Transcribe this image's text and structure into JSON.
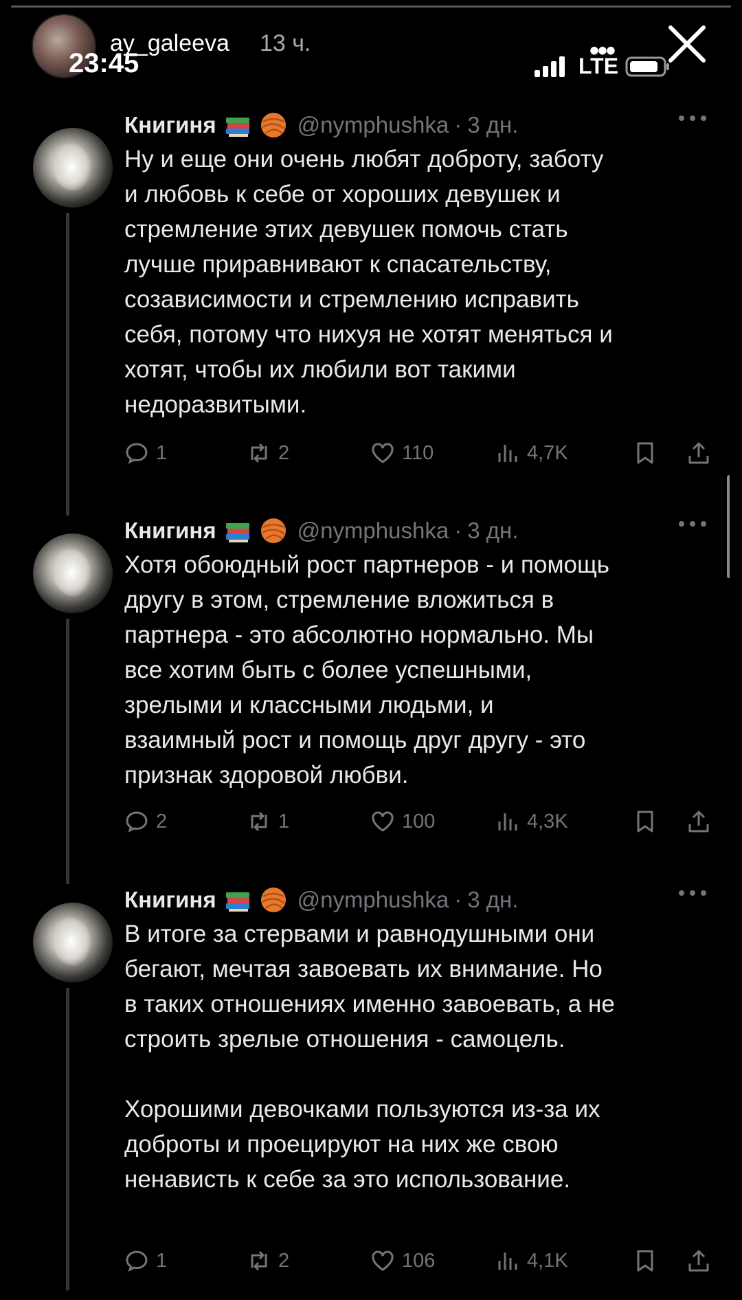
{
  "story": {
    "username": "ay_galeeva",
    "posted_ago": "13 ч.",
    "clock": "23:45",
    "network": "LTE",
    "more": "•••"
  },
  "colors": {
    "background": "#000000",
    "text": "#e7e9ea",
    "muted": "#71767b",
    "thread_line": "#333639"
  },
  "tweets": [
    {
      "name": "Книгиня",
      "emoji": [
        "books-emoji",
        "yarn-emoji"
      ],
      "handle": "@nymphushka",
      "dot": "·",
      "date": "3 дн.",
      "text": "Ну и еще они очень любят доброту, заботу\nи любовь к себе от хороших девушек и\nстремление этих девушек помочь стать\nлучше приравнивают к спасательству,\nсозависимости и стремлению исправить\nсебя, потому что нихуя не хотят меняться и\nхотят, чтобы их любили вот такими\nнедоразвитыми.",
      "replies": "1",
      "retweets": "2",
      "likes": "110",
      "views": "4,7K"
    },
    {
      "name": "Книгиня",
      "emoji": [
        "books-emoji",
        "yarn-emoji"
      ],
      "handle": "@nymphushka",
      "dot": "·",
      "date": "3 дн.",
      "text": "Хотя обоюдный рост партнеров - и помощь\nдругу в этом, стремление вложиться в\nпартнера - это абсолютно нормально. Мы\nвсе хотим быть с более успешными,\nзрелыми и классными людьми, и\nвзаимный рост и помощь друг другу - это\nпризнак здоровой любви.",
      "replies": "2",
      "retweets": "1",
      "likes": "100",
      "views": "4,3K"
    },
    {
      "name": "Книгиня",
      "emoji": [
        "books-emoji",
        "yarn-emoji"
      ],
      "handle": "@nymphushka",
      "dot": "·",
      "date": "3 дн.",
      "text": "В итоге за стервами и равнодушными они\nбегают, мечтая завоевать их внимание. Но\nв таких отношениях именно завоевать, а не\nстроить зрелые отношения - самоцель.\n\nХорошими девочками пользуются из-за их\nдоброты и проецируют на них же свою\nненависть к себе за это использование.",
      "replies": "1",
      "retweets": "2",
      "likes": "106",
      "views": "4,1K"
    }
  ]
}
